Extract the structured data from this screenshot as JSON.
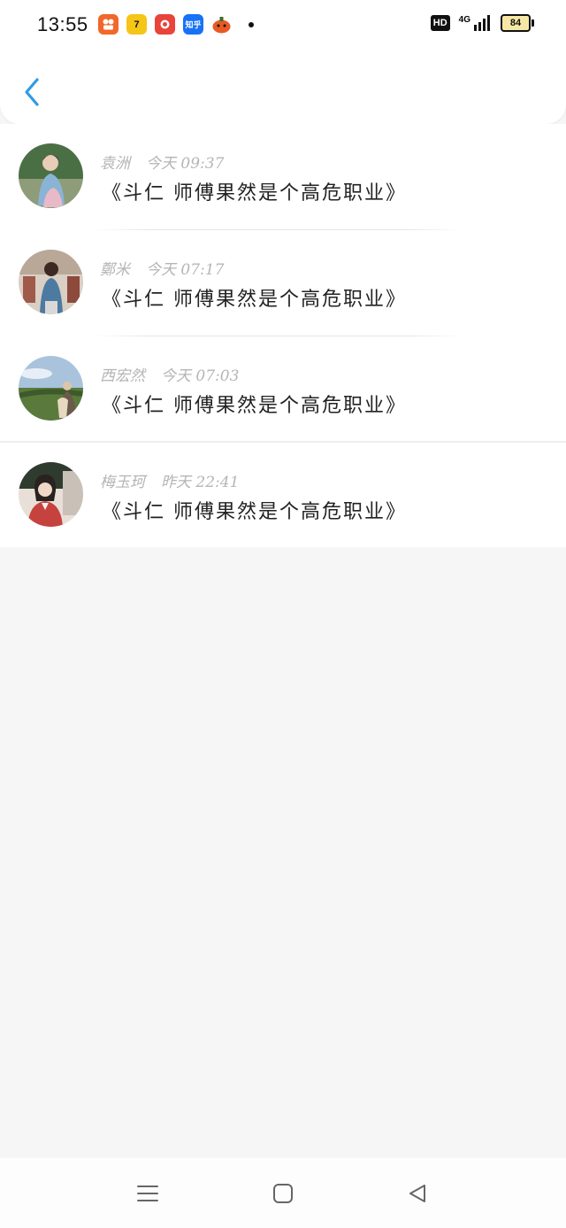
{
  "status_bar": {
    "time": "13:55",
    "app_icons": [
      {
        "name": "kuaishou-icon",
        "text": "",
        "color": "#f2672a"
      },
      {
        "name": "qimao-icon",
        "text": "7",
        "color": "#f5c518"
      },
      {
        "name": "pinduoduo-icon",
        "text": "",
        "color": "#e8443a"
      },
      {
        "name": "zhihu-icon",
        "text": "知乎",
        "color": "#1772f6"
      },
      {
        "name": "game-icon",
        "text": "",
        "color": "#e85a25"
      }
    ],
    "hd_label": "HD",
    "network_label": "4G",
    "battery_level": "84"
  },
  "comments": [
    {
      "name": "袁洲",
      "time": "今天 09:37",
      "text": "《斗仁 师傅果然是个高危职业》",
      "avatar_colors": [
        "#3e6b3c",
        "#8ab4d6",
        "#e9b9c7"
      ]
    },
    {
      "name": "鄭米",
      "time": "今天 07:17",
      "text": "《斗仁 师傅果然是个高危职业》",
      "avatar_colors": [
        "#d9cfc4",
        "#4d7aa0",
        "#a05a4a"
      ]
    },
    {
      "name": "西宏然",
      "time": "今天 07:03",
      "text": "《斗仁 师傅果然是个高危职业》",
      "avatar_colors": [
        "#a9c3dd",
        "#5a7a3c",
        "#6b5a4a"
      ]
    },
    {
      "name": "梅玉珂",
      "time": "昨天 22:41",
      "text": "《斗仁 师傅果然是个高危职业》",
      "avatar_colors": [
        "#2f3b2f",
        "#c6423f",
        "#e8e0d8"
      ]
    }
  ],
  "colors": {
    "accent": "#2f9be6",
    "background": "#f7f6f7",
    "meta_text": "#b5b5b5"
  }
}
